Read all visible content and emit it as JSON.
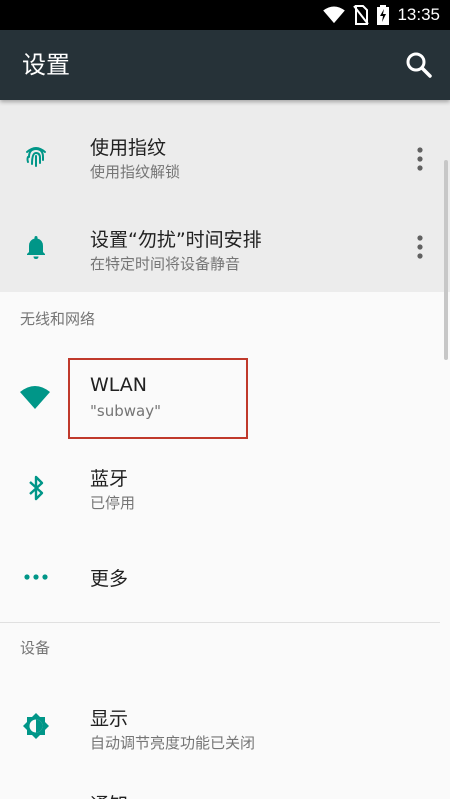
{
  "status_bar": {
    "time": "13:35",
    "icons": [
      "wifi-icon",
      "no-sim-icon",
      "battery-charging-icon"
    ]
  },
  "app_bar": {
    "title": "设置",
    "search_icon": "search-icon"
  },
  "suggestions": [
    {
      "title": "使用指纹",
      "subtitle": "使用指纹解锁",
      "icon": "fingerprint-icon"
    },
    {
      "title": "设置“勿扰”时间安排",
      "subtitle": "在特定时间将设备静音",
      "icon": "bell-icon"
    }
  ],
  "sections": {
    "wireless": {
      "header": "无线和网络",
      "items": [
        {
          "title": "WLAN",
          "subtitle": "\"subway\"",
          "icon": "wifi-icon"
        },
        {
          "title": "蓝牙",
          "subtitle": "已停用",
          "icon": "bluetooth-icon"
        },
        {
          "title": "更多",
          "icon": "more-horizontal-icon"
        }
      ]
    },
    "device": {
      "header": "设备",
      "items": [
        {
          "title": "显示",
          "subtitle": "自动调节亮度功能已关闭",
          "icon": "brightness-icon"
        },
        {
          "title": "通知"
        }
      ]
    }
  },
  "colors": {
    "accent": "#009688",
    "app_bar": "#263238",
    "highlight": "#c0392b"
  }
}
